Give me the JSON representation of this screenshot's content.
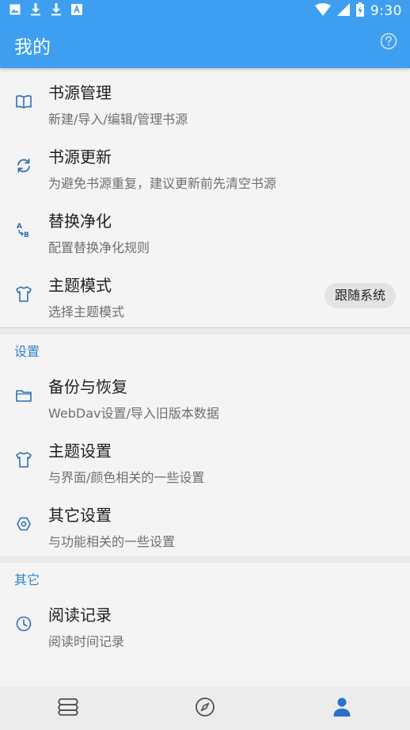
{
  "status_bar": {
    "time": "9:30",
    "icons": [
      "image-icon",
      "download-icon",
      "download-icon",
      "a-box-icon",
      "wifi-icon",
      "signal-icon",
      "battery-icon"
    ]
  },
  "app_bar": {
    "title": "我的",
    "help_icon": "help-circle-icon"
  },
  "main_items": [
    {
      "icon": "book-icon",
      "title": "书源管理",
      "subtitle": "新建/导入/编辑/管理书源"
    },
    {
      "icon": "sync-icon",
      "title": "书源更新",
      "subtitle": "为避免书源重复，建议更新前先清空书源"
    },
    {
      "icon": "replace-ab-icon",
      "title": "替换净化",
      "subtitle": "配置替换净化规则"
    },
    {
      "icon": "shirt-icon",
      "title": "主题模式",
      "subtitle": "选择主题模式",
      "chip": "跟随系统"
    }
  ],
  "settings_section": {
    "header": "设置",
    "items": [
      {
        "icon": "folder-icon",
        "title": "备份与恢复",
        "subtitle": "WebDav设置/导入旧版本数据"
      },
      {
        "icon": "shirt-icon",
        "title": "主题设置",
        "subtitle": "与界面/颜色相关的一些设置"
      },
      {
        "icon": "settings-hex-icon",
        "title": "其它设置",
        "subtitle": "与功能相关的一些设置"
      }
    ]
  },
  "other_section": {
    "header": "其它",
    "items": [
      {
        "icon": "clock-icon",
        "title": "阅读记录",
        "subtitle": "阅读时间记录"
      }
    ]
  },
  "bottom_nav": {
    "tabs": [
      {
        "icon": "bookshelf-icon",
        "active": false
      },
      {
        "icon": "compass-icon",
        "active": false
      },
      {
        "icon": "person-icon",
        "active": true
      }
    ]
  },
  "colors": {
    "app_bar": "#3e9ff0",
    "accent": "#2f83d0",
    "icon_tint": "#2f6fb5",
    "active_nav": "#2a6fca",
    "inactive_nav": "#505050"
  }
}
